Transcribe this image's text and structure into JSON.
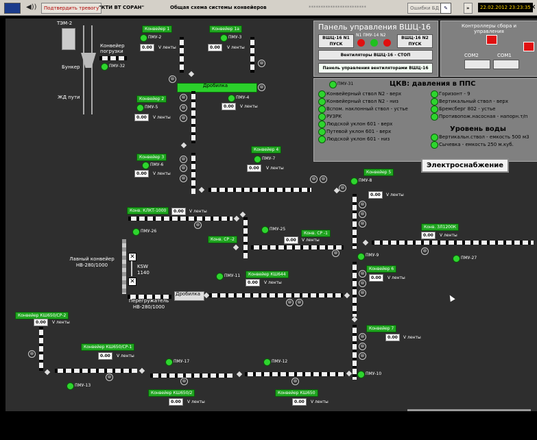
{
  "topbar": {
    "ack_label": "Подтвердить тревогу",
    "company": "\"КТИ ВТ СОРАН\"",
    "screen_title": "Общая схема системы конвейеров",
    "stars": "************************",
    "db_errors": "Ошибки БД",
    "datetime": "22.02.2012 23:23:35"
  },
  "plant": {
    "tem2": "ТЭМ-2",
    "loading_conveyor": "Конвейер погрузки",
    "bunker": "Бункер",
    "rail": "ЖД пути",
    "crusher1": "Дробилка",
    "crusher2": "Дробилка",
    "face_conveyor": "Лавный конвейер НВ-280/1000",
    "ksw": "KSW 1140",
    "reloader": "Перегружатель НВ-280/1000"
  },
  "conveyors": {
    "k1": "Конвейер 1",
    "k1a": "Конвейер 1а",
    "k2": "Конвейер 2",
    "k3": "Конвейер 3",
    "k4": "Конвейер 4",
    "k5": "Конвейер 5",
    "k6": "Конвейер 6",
    "k7": "Конвейер 7",
    "klkt": "Конв. КЛКТ-1000",
    "cp2": "Конв. СР -2",
    "cp1": "Конв. СР -1",
    "ksh644": "Конвейер КШ644",
    "zl1200": "Конв. 3Л1200К",
    "ksh650cp2": "Конвейер КШ650/СР-2",
    "ksh650cp1": "Конвейер КШ650/СР-1",
    "ksh650_2": "Конвейер КШ650/2",
    "ksh650": "Конвейер КШ650"
  },
  "tape_value": "0.00",
  "tape_unit": "V ленты",
  "pmu": {
    "p2": "ПМУ-2",
    "p3": "ПМУ-3",
    "p4": "ПМУ-4",
    "p5": "ПМУ-5",
    "p6": "ПМУ-6",
    "p7": "ПМУ-7",
    "p8": "ПМУ-8",
    "p9": "ПМУ-9",
    "p10": "ПМУ-10",
    "p11": "ПМУ-11",
    "p12": "ПМУ-12",
    "p13": "ПМУ-13",
    "p17": "ПМУ-17",
    "p25": "ПМУ-25",
    "p26": "ПМУ-26",
    "p27": "ПМУ-27",
    "p31": "ПМУ-31",
    "p32": "ПМУ-32"
  },
  "vsh_panel": {
    "title": "Панель управления ВШЦ-16",
    "n1_label": "ВШЦ-16  N1",
    "n1_action": "ПУСК",
    "n2_label": "ВШЦ-16  N2",
    "n2_action": "ПУСК",
    "lamp_labels": "N1  ПМУ-14  N2",
    "fans_label": "Вентиляторы ВШЦ-16   -   СТОП",
    "fans_panel": "Панель управления вентиляторами ВШЦ-16"
  },
  "controllers": {
    "title": "Контроллеры сбора и управления",
    "com2": "COM2",
    "com1": "COM1"
  },
  "pressure": {
    "title": "ЦКВ: давления в ППС",
    "left": [
      "Конвейерный ствол N2 - верх",
      "Конвейерный ствол N2 - низ",
      "Вспом. наклонный ствол - устье",
      "РУЗРК",
      "Людской уклон 601 - верх",
      "Путевой уклон 601 - верх",
      "Людской уклон 601 - низ"
    ],
    "right": [
      "Горизонт - 9",
      "Вертикальный ствол - верх",
      "Бремсберг 802 - устье",
      "Противопож.насосная - напорн.т/п"
    ],
    "water_title": "Уровень воды",
    "water": [
      "Вертикальн.ствол - емкость 500 м3",
      "Сычевка - емкость 250 м.куб."
    ]
  },
  "power_button": "Электроснабжение"
}
